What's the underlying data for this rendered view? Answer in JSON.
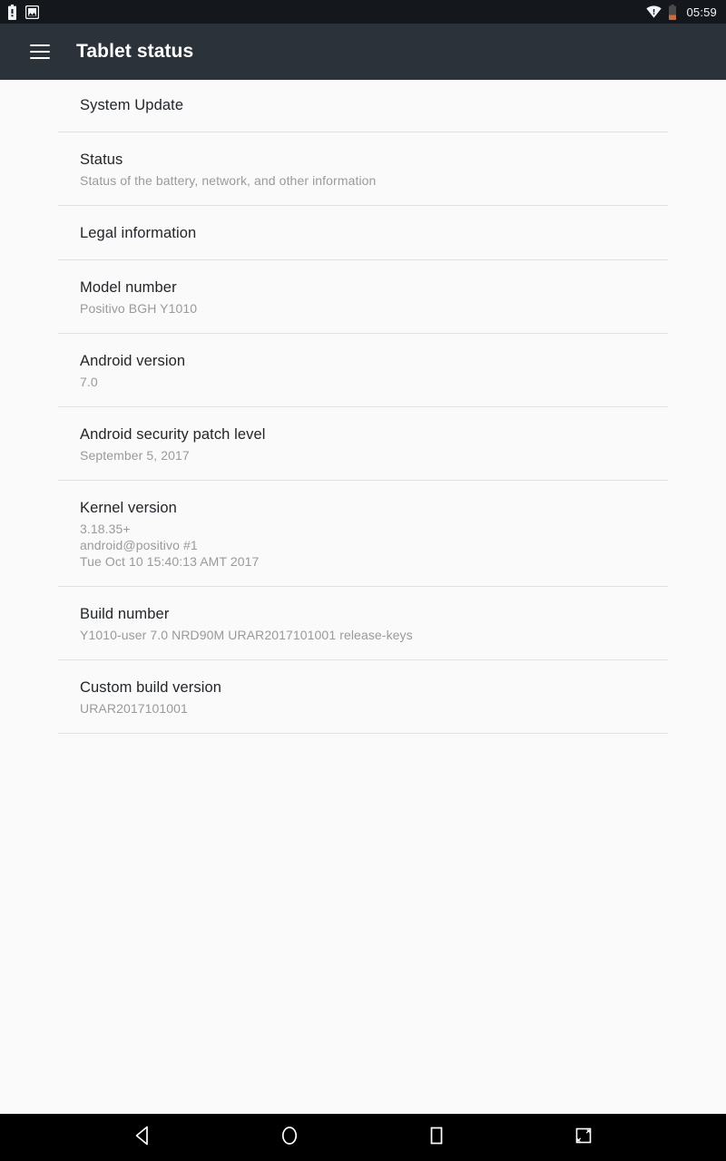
{
  "status_bar": {
    "time": "05:59",
    "left_icons": [
      {
        "name": "battery-alert-icon",
        "label": "battery-alert"
      },
      {
        "name": "screenshot-notification-icon",
        "label": "screenshot-capture"
      }
    ],
    "right_icons": [
      {
        "name": "wifi-no-internet-icon",
        "label": "wifi-exclamation"
      },
      {
        "name": "battery-low-icon",
        "label": "battery-low"
      }
    ],
    "colors": {
      "background": "#14181c",
      "foreground": "#f2f3f4",
      "battery_low": "#cf6a3a"
    }
  },
  "toolbar": {
    "menu_icon": "hamburger-menu-icon",
    "title": "Tablet status",
    "colors": {
      "background": "#2b323a",
      "text": "#ffffff"
    }
  },
  "list": {
    "items": [
      {
        "title": "System Update",
        "sub": []
      },
      {
        "title": "Status",
        "sub": [
          "Status of the battery, network, and other information"
        ]
      },
      {
        "title": "Legal information",
        "sub": []
      },
      {
        "title": "Model number",
        "sub": [
          "Positivo BGH Y1010"
        ]
      },
      {
        "title": "Android version",
        "sub": [
          "7.0"
        ]
      },
      {
        "title": "Android security patch level",
        "sub": [
          "September 5, 2017"
        ]
      },
      {
        "title": "Kernel version",
        "sub": [
          "3.18.35+",
          "android@positivo #1",
          "Tue Oct 10 15:40:13 AMT 2017"
        ]
      },
      {
        "title": "Build number",
        "sub": [
          "Y1010-user 7.0 NRD90M URAR2017101001 release-keys"
        ]
      },
      {
        "title": "Custom build version",
        "sub": [
          "URAR2017101001"
        ]
      }
    ],
    "colors": {
      "background": "#fafafa",
      "title": "#22252a",
      "subtitle": "#9a9a9a",
      "divider": "#e2e2e2"
    }
  },
  "navigation_bar": {
    "buttons": [
      {
        "name": "nav-back-button",
        "icon": "back-triangle-icon"
      },
      {
        "name": "nav-home-button",
        "icon": "home-circle-icon"
      },
      {
        "name": "nav-recents-button",
        "icon": "recents-square-icon"
      },
      {
        "name": "nav-screenshot-button",
        "icon": "screenshot-icon"
      }
    ],
    "colors": {
      "background": "#000000",
      "foreground": "#ffffff"
    }
  }
}
